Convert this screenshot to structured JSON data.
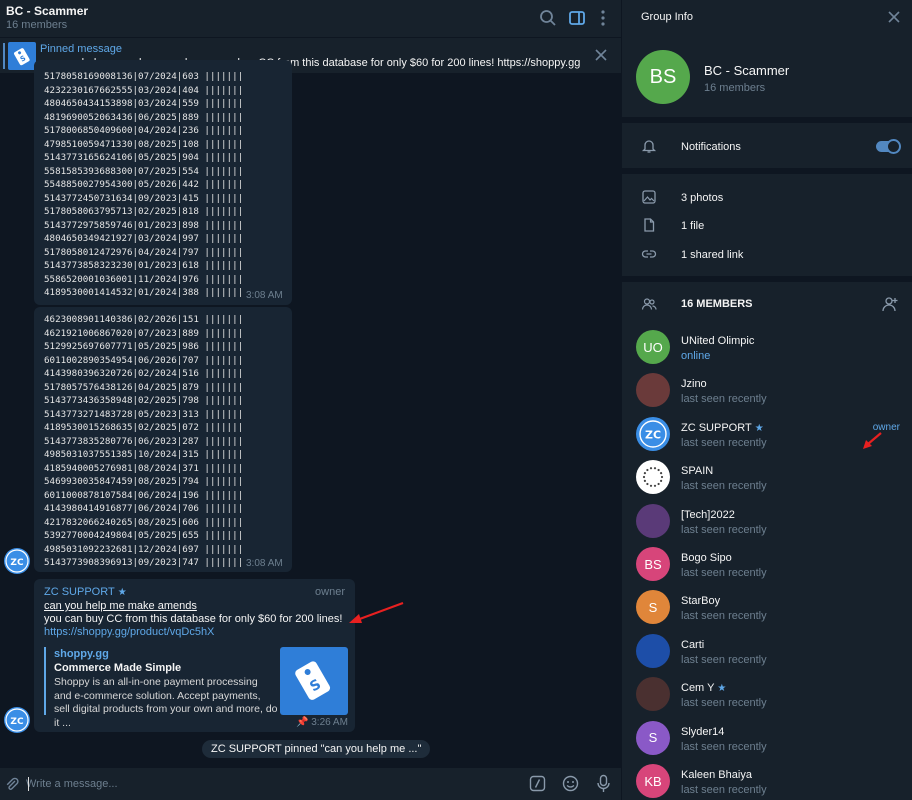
{
  "chat": {
    "title": "BC - Scammer",
    "subtitle": "16 members",
    "pinned": {
      "label": "Pinned message",
      "text_underlined": "can you help me make amends",
      "text_rest": " you can buy CC from this database for only $60 for 200 lines! https://shoppy.gg/produ..."
    },
    "block1": {
      "lines": [
        "5178058169008136|07/2024|603 |||||||",
        "4232230167662555|03/2024|404 |||||||",
        "4804650434153898|03/2024|559 |||||||",
        "4819690052063436|06/2025|889 |||||||",
        "5178006850409600|04/2024|236 |||||||",
        "4798510059471330|08/2025|108 |||||||",
        "5143773165624106|05/2025|904 |||||||",
        "5581585393688300|07/2025|554 |||||||",
        "5548850027954300|05/2026|442 |||||||",
        "5143772450731634|09/2023|415 |||||||",
        "5178058063795713|02/2025|818 |||||||",
        "5143772975859746|01/2023|898 |||||||",
        "4804650349421927|03/2024|997 |||||||",
        "5178058012472976|04/2024|797 |||||||",
        "5143773858323230|01/2023|618 |||||||",
        "5586520001036001|11/2024|976 |||||||",
        "4189530001414532|01/2024|388 |||||||"
      ],
      "time": "3:08 AM"
    },
    "block2": {
      "lines": [
        "4623008901140386|02/2026|151 |||||||",
        "4621921006867020|07/2023|889 |||||||",
        "5129925697607771|05/2025|986 |||||||",
        "6011002890354954|06/2026|707 |||||||",
        "4143980396320726|02/2024|516 |||||||",
        "5178057576438126|04/2025|879 |||||||",
        "5143773436358948|02/2025|798 |||||||",
        "5143773271483728|05/2023|313 |||||||",
        "4189530015268635|02/2025|072 |||||||",
        "5143773835280776|06/2023|287 |||||||",
        "4985031037551385|10/2024|315 |||||||",
        "4185940005276981|08/2024|371 |||||||",
        "5469930035847459|08/2025|794 |||||||",
        "6011000878107584|06/2024|196 |||||||",
        "4143980414916877|06/2024|706 |||||||",
        "4217832066240265|08/2025|606 |||||||",
        "5392770004249804|05/2025|655 |||||||",
        "4985031092232681|12/2024|697 |||||||",
        "5143773908396913|09/2023|747 |||||||"
      ],
      "time": "3:08 AM"
    },
    "message": {
      "author": "ZC SUPPORT",
      "role": "owner",
      "line1": "can you help me make amends",
      "line2": "you can buy CC from this database for only $60 for 200 lines!",
      "link": "https://shoppy.gg/product/vqDc5hX",
      "preview": {
        "site": "shoppy.gg",
        "title": "Commerce Made Simple",
        "desc": "Shoppy is an all-in-one payment processing and e-commerce solution. Accept payments, sell digital products from your own and more, do it ..."
      },
      "time": "3:26 AM"
    },
    "service": "ZC SUPPORT pinned \"can you help me ...\"",
    "composer_placeholder": "Write a message..."
  },
  "info": {
    "title": "Group Info",
    "avatar_initials": "BS",
    "name": "BC - Scammer",
    "members": "16 members",
    "notifications": "Notifications",
    "photos": "3 photos",
    "files": "1 file",
    "links": "1 shared link",
    "members_header": "16 MEMBERS",
    "member_list": [
      {
        "initials": "UO",
        "name": "UNited Olimpic",
        "status": "online",
        "color": "#55a84c"
      },
      {
        "initials": "",
        "name": "Jzino",
        "status": "last seen recently",
        "color": "#6a3a3a"
      },
      {
        "initials": "ZC",
        "name": "ZC SUPPORT",
        "status": "last seen recently",
        "role": "owner",
        "color": "#3a8ee6"
      },
      {
        "initials": "",
        "name": "SPAIN",
        "status": "last seen recently",
        "color": "#ffffff"
      },
      {
        "initials": "",
        "name": "[Tech]2022",
        "status": "last seen recently",
        "color": "#5a3a78"
      },
      {
        "initials": "BS",
        "name": "Bogo Sipo",
        "status": "last seen recently",
        "color": "#d7457a"
      },
      {
        "initials": "S",
        "name": "StarBoy",
        "status": "last seen recently",
        "color": "#e0863a"
      },
      {
        "initials": "",
        "name": "Carti",
        "status": "last seen recently",
        "color": "#1d4ea8"
      },
      {
        "initials": "",
        "name": "Cem Y",
        "status": "last seen recently",
        "color": "#4a3030"
      },
      {
        "initials": "S",
        "name": "Slyder14",
        "status": "last seen recently",
        "color": "#8a59c7"
      },
      {
        "initials": "KB",
        "name": "Kaleen Bhaiya",
        "status": "last seen recently",
        "color": "#d7457a"
      }
    ]
  }
}
